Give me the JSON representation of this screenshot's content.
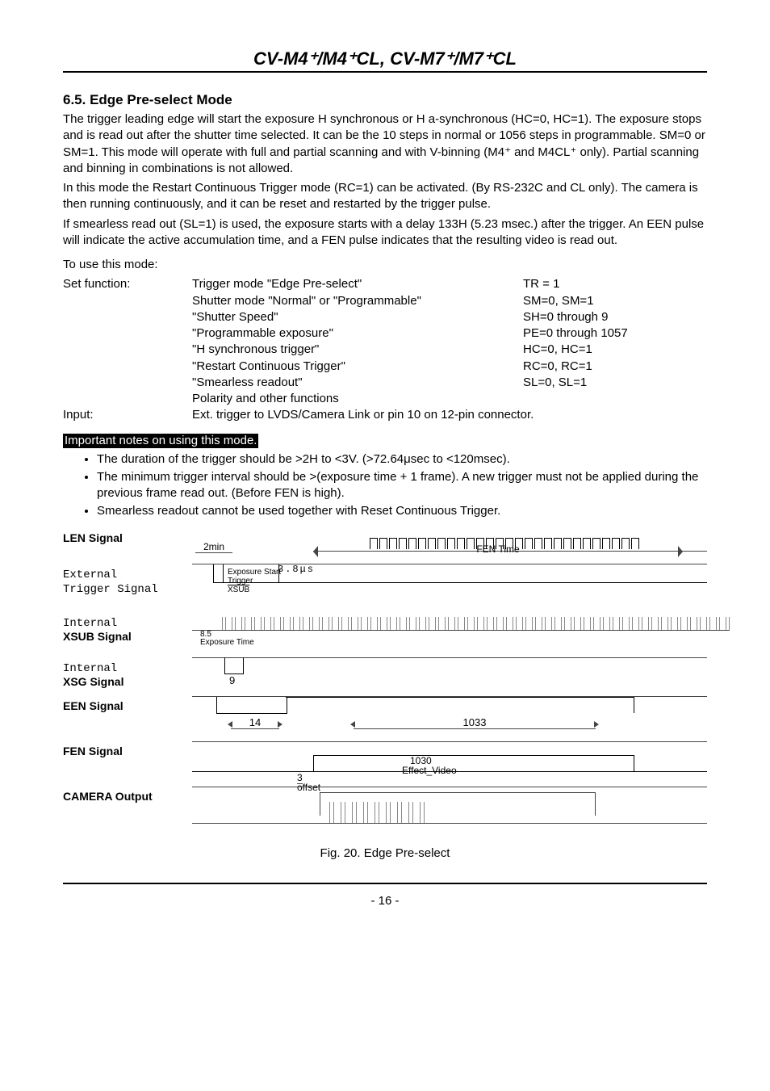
{
  "header": {
    "title": "CV-M4⁺/M4⁺CL, CV-M7⁺/M7⁺CL"
  },
  "section": {
    "number_title": "6.5. Edge Pre-select Mode",
    "para1": "The trigger leading edge will start the exposure H synchronous or H a-synchronous (HC=0, HC=1). The exposure stops and is read out after the shutter time selected. It can be the 10 steps in normal or 1056 steps in programmable. SM=0 or SM=1. This mode will operate with full and partial scanning and with V-binning (M4⁺ and M4CL⁺ only). Partial scanning and binning in combinations is not allowed.",
    "para2": "In this mode the Restart Continuous Trigger mode (RC=1) can be activated. (By RS-232C and CL only). The camera is then running continuously, and it can be reset and restarted by the trigger pulse.",
    "para3": "If smearless read out (SL=1) is used, the exposure starts with a delay 133H (5.23 msec.) after the trigger. An EEN pulse will indicate the active accumulation time, and a FEN pulse indicates that the resulting video is read out."
  },
  "use": {
    "intro": "To use this mode:",
    "left_setfn": "Set function:",
    "left_input": "Input:",
    "rows": [
      {
        "mid": "Trigger mode \"Edge Pre-select\"",
        "right": "TR = 1"
      },
      {
        "mid": "Shutter mode \"Normal\" or \"Programmable\"",
        "right": "SM=0, SM=1"
      },
      {
        "mid": "\"Shutter Speed\"",
        "right": "SH=0 through 9"
      },
      {
        "mid": "\"Programmable exposure\"",
        "right": "PE=0 through 1057"
      },
      {
        "mid": "\"H synchronous trigger\"",
        "right": "HC=0, HC=1"
      },
      {
        "mid": "\"Restart Continuous Trigger\"",
        "right": "RC=0, RC=1"
      },
      {
        "mid": "\"Smearless readout\"",
        "right": "SL=0, SL=1"
      },
      {
        "mid": "Polarity and other functions",
        "right": ""
      }
    ],
    "input_row": "Ext. trigger to LVDS/Camera Link or pin 10 on 12-pin connector."
  },
  "important": {
    "title": "Important notes on using this mode.",
    "items": [
      "The duration of the trigger should be >2H to <3V. (>72.64μsec to <120msec).",
      "The minimum trigger interval should be >(exposure time + 1 frame). A new trigger must not be applied during the previous frame read out. (Before FEN is high).",
      "Smearless readout cannot be used together with Reset Continuous Trigger."
    ]
  },
  "diagram": {
    "labels": {
      "len": "LEN Signal",
      "ext_l1": "External",
      "ext_l2": "Trigger Signal",
      "xsub_l1": "Internal",
      "xsub_l2": "XSUB Signal",
      "xsg_l1": "Internal",
      "xsg_l2": "XSG Signal",
      "een": "EEN Signal",
      "fen": "FEN Signal",
      "cam": "CAMERA Output"
    },
    "two_min": "2min",
    "fen_time": "FEN Time",
    "trig_anno1": "Exposure Start",
    "trig_anno2": "Trigger",
    "trig_anno3": "XSUB",
    "trig_dim": "3.8μs",
    "xsub_lab": "8.5\nExposure Time",
    "xsg_lab": "9",
    "een_14": "14",
    "een_1033": "1033",
    "fen_off1": "3",
    "fen_off2": "offset",
    "fen_1030": "1030",
    "fen_eff": "Effect_Video"
  },
  "caption": "Fig. 20. Edge Pre-select",
  "pagenum": "- 16 -"
}
